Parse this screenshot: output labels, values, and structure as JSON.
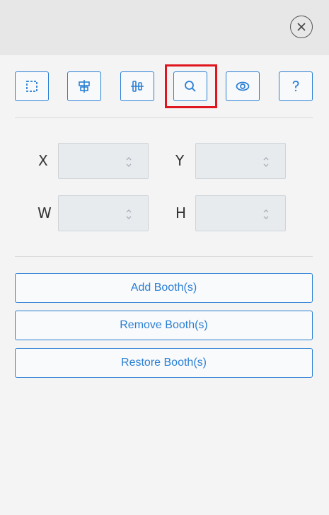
{
  "toolbar": {
    "tools": [
      {
        "icon": "select-area-icon"
      },
      {
        "icon": "align-center-icon"
      },
      {
        "icon": "distribute-icon"
      },
      {
        "icon": "search-icon"
      },
      {
        "icon": "eye-icon"
      },
      {
        "icon": "help-icon"
      }
    ],
    "highlighted_tool": "search-icon"
  },
  "fields": {
    "x_label": "X",
    "y_label": "Y",
    "w_label": "W",
    "h_label": "H",
    "x_value": "",
    "y_value": "",
    "w_value": "",
    "h_value": ""
  },
  "actions": {
    "add_label": "Add Booth(s)",
    "remove_label": "Remove Booth(s)",
    "restore_label": "Restore Booth(s)"
  },
  "colors": {
    "accent": "#2a7fd4",
    "highlight": "#e0161e"
  }
}
